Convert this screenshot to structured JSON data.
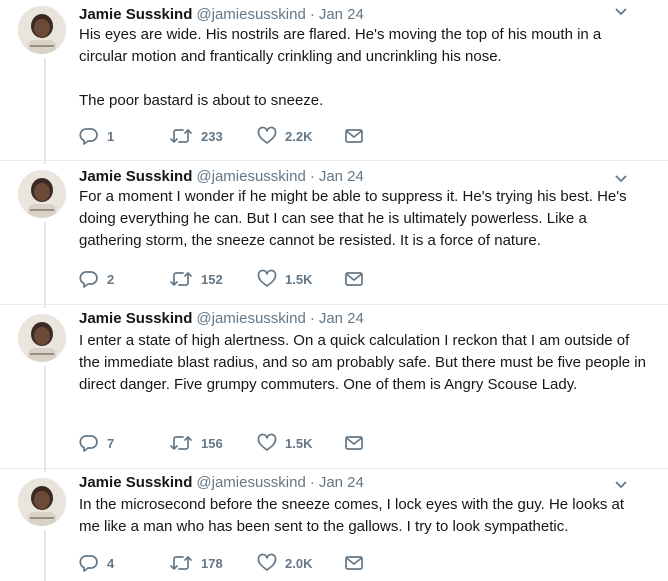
{
  "tweets": [
    {
      "name": "Jamie Susskind",
      "handle": "@jamiesusskind",
      "separator": "·",
      "date": "Jan 24",
      "text": "His eyes are wide. His nostrils are flared. He's moving the top of his mouth in a circular motion and frantically crinkling and uncrinkling his nose.\n\nThe poor bastard is about to sneeze.",
      "replies": "1",
      "retweets": "233",
      "likes": "2.2K"
    },
    {
      "name": "Jamie Susskind",
      "handle": "@jamiesusskind",
      "separator": "·",
      "date": "Jan 24",
      "text": "For a moment I wonder if he might be able to suppress it. He's trying his best. He's doing everything he can. But I can see that he is ultimately powerless. Like a gathering storm, the sneeze cannot be resisted. It is a force of nature.",
      "replies": "2",
      "retweets": "152",
      "likes": "1.5K"
    },
    {
      "name": "Jamie Susskind",
      "handle": "@jamiesusskind",
      "separator": "·",
      "date": "Jan 24",
      "text": "I enter a state of high alertness. On a quick calculation I reckon that I am outside of the immediate blast radius, and so am probably safe. But there must be five people in direct danger. Five grumpy commuters. One of them is Angry Scouse Lady.",
      "replies": "7",
      "retweets": "156",
      "likes": "1.5K"
    },
    {
      "name": "Jamie Susskind",
      "handle": "@jamiesusskind",
      "separator": "·",
      "date": "Jan 24",
      "text": "In the microsecond before the sneeze comes, I lock eyes with the guy. He looks at me like a man who has been sent to the gallows. I try to look sympathetic.",
      "replies": "4",
      "retweets": "178",
      "likes": "2.0K"
    }
  ],
  "colors": {
    "text": "#14171a",
    "secondary": "#657786",
    "border": "#e6ecf0",
    "thread_line": "#e1e8ed"
  },
  "icons": [
    "reply-icon",
    "retweet-icon",
    "like-icon",
    "direct-message-icon",
    "caret-down-icon"
  ]
}
